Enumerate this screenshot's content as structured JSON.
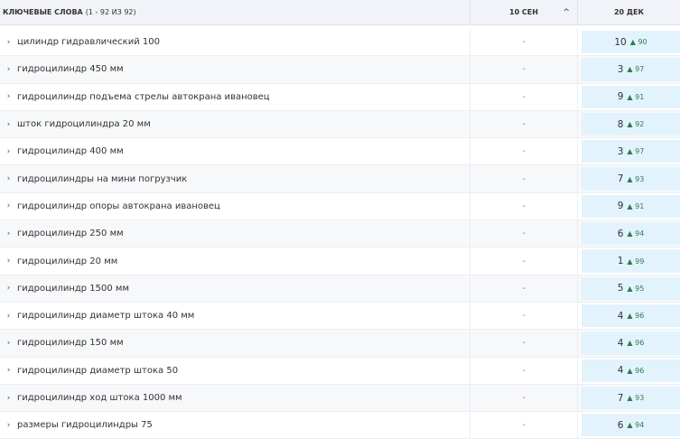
{
  "header": {
    "keywords": "КЛЮЧЕВЫЕ СЛОВА",
    "count": "(1 - 92 ИЗ 92)",
    "col1": "10 СЕН",
    "col2": "20 ДЕК"
  },
  "colors": {
    "highlight": "#e3f3fd",
    "up": "#2e7d4f"
  },
  "rows": [
    {
      "kw": "цилиндр гидравлический 100",
      "c1": "-",
      "pos": "10",
      "chg": "▲ 90"
    },
    {
      "kw": "гидроцилиндр 450 мм",
      "c1": "-",
      "pos": "3",
      "chg": "▲ 97"
    },
    {
      "kw": "гидроцилиндр подъема стрелы автокрана ивановец",
      "c1": "-",
      "pos": "9",
      "chg": "▲ 91"
    },
    {
      "kw": "шток гидроцилиндра 20 мм",
      "c1": "-",
      "pos": "8",
      "chg": "▲ 92"
    },
    {
      "kw": "гидроцилиндр 400 мм",
      "c1": "-",
      "pos": "3",
      "chg": "▲ 97"
    },
    {
      "kw": "гидроцилиндры на мини погрузчик",
      "c1": "-",
      "pos": "7",
      "chg": "▲ 93"
    },
    {
      "kw": "гидроцилиндр опоры автокрана ивановец",
      "c1": "-",
      "pos": "9",
      "chg": "▲ 91"
    },
    {
      "kw": "гидроцилиндр 250 мм",
      "c1": "-",
      "pos": "6",
      "chg": "▲ 94"
    },
    {
      "kw": "гидроцилиндр 20 мм",
      "c1": "-",
      "pos": "1",
      "chg": "▲ 99"
    },
    {
      "kw": "гидроцилиндр 1500 мм",
      "c1": "-",
      "pos": "5",
      "chg": "▲ 95"
    },
    {
      "kw": "гидроцилиндр диаметр штока 40 мм",
      "c1": "-",
      "pos": "4",
      "chg": "▲ 96"
    },
    {
      "kw": "гидроцилиндр 150 мм",
      "c1": "-",
      "pos": "4",
      "chg": "▲ 96"
    },
    {
      "kw": "гидроцилиндр диаметр штока 50",
      "c1": "-",
      "pos": "4",
      "chg": "▲ 96"
    },
    {
      "kw": "гидроцилиндр ход штока 1000 мм",
      "c1": "-",
      "pos": "7",
      "chg": "▲ 93"
    },
    {
      "kw": "размеры гидроцилиндры 75",
      "c1": "-",
      "pos": "6",
      "chg": "▲ 94"
    }
  ]
}
